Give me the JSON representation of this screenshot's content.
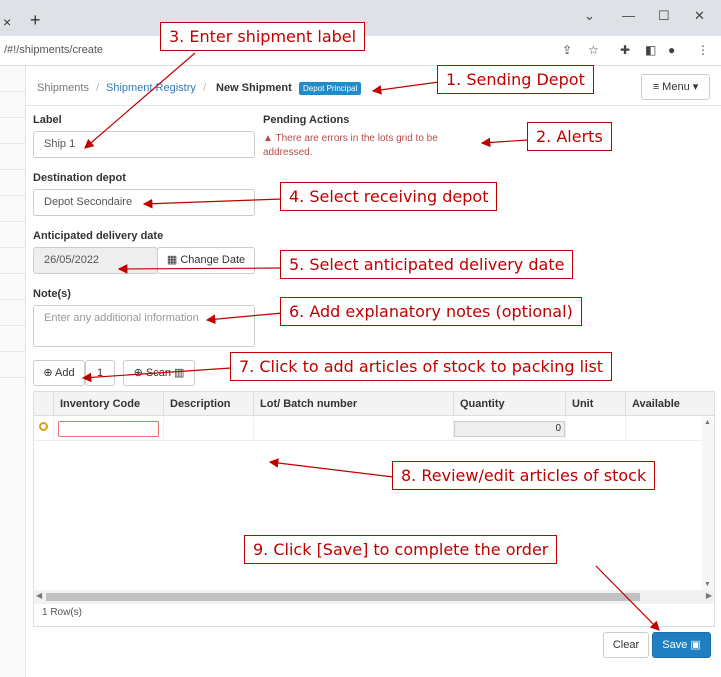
{
  "browser": {
    "tab_close": "×",
    "new_tab": "+",
    "url": "/#!/shipments/create",
    "win_min": "⌄",
    "win_min2": "—",
    "win_max": "☐",
    "win_close": "✕"
  },
  "breadcrumb": {
    "item1": "Shipments",
    "item2": "Shipment Registry",
    "sep": "/",
    "current": "New Shipment",
    "badge": "Depot Principal"
  },
  "menu": {
    "label": "≡ Menu ▾"
  },
  "form": {
    "label_label": "Label",
    "label_value": "Ship 1",
    "pending_label": "Pending Actions",
    "pending_text": "There are errors in the lots grid to be addressed.",
    "destination_label": "Destination depot",
    "destination_value": "Depot Secondaire",
    "date_label": "Anticipated delivery date",
    "date_value": "26/05/2022",
    "change_date": "Change Date",
    "notes_label": "Note(s)",
    "notes_placeholder": "Enter any additional information",
    "add_label": "Add",
    "add_count": "1",
    "scan_label": "Scan"
  },
  "grid": {
    "columns": [
      "Inventory Code",
      "Description",
      "Lot/ Batch number",
      "Quantity",
      "Unit",
      "Available"
    ],
    "row_quantity": "0",
    "footer": "1 Row(s)"
  },
  "actions": {
    "clear": "Clear",
    "save": "Save"
  },
  "callouts": {
    "c1": "1. Sending Depot",
    "c2": "2. Alerts",
    "c3": "3. Enter shipment label",
    "c4": "4. Select receiving depot",
    "c5": "5. Select anticipated delivery date",
    "c6": "6.  Add explanatory notes (optional)",
    "c7": "7.  Click to add articles of stock to packing list",
    "c8": "8. Review/edit  articles of stock",
    "c9": "9.  Click [Save]  to complete the order"
  },
  "colors": {
    "annotation": "#c00000",
    "primary": "#1f7fc1",
    "badge": "#1f8cc9",
    "alert": "#b94a48"
  }
}
